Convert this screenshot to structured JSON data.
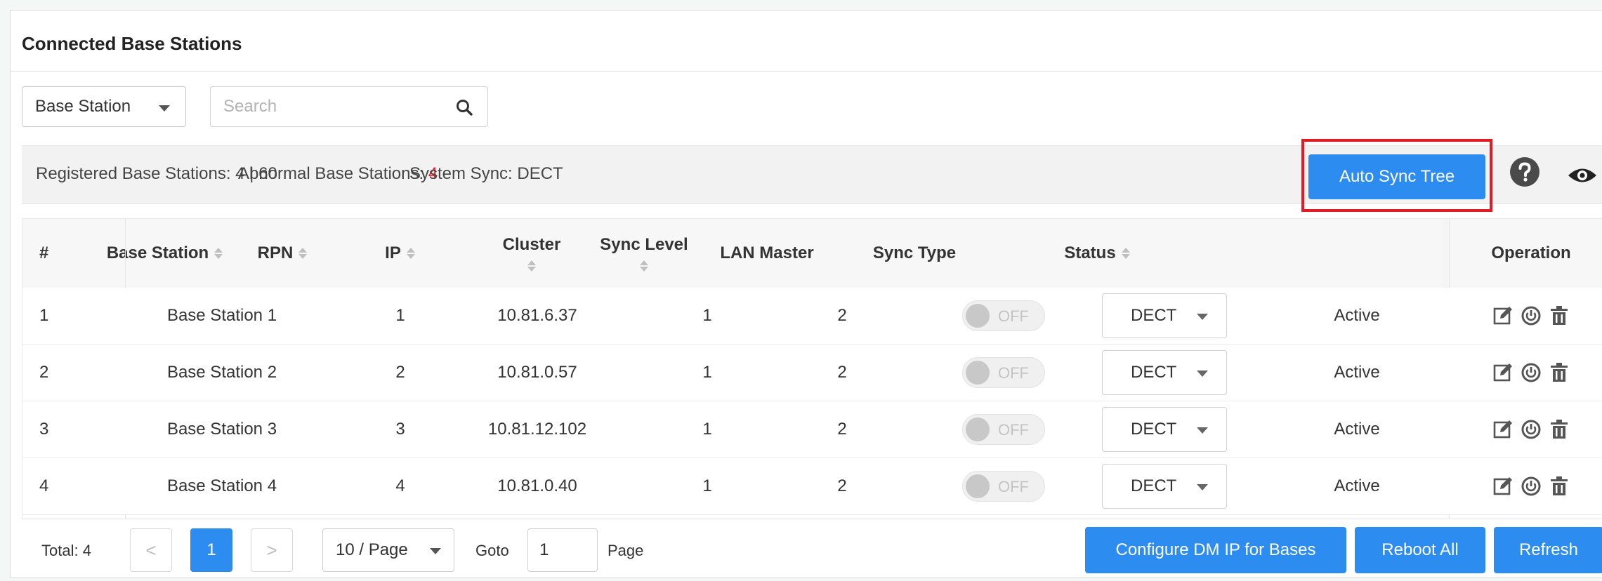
{
  "panel": {
    "title": "Connected Base Stations"
  },
  "filter": {
    "type_selected": "Base Station",
    "search_placeholder": "Search"
  },
  "stats": {
    "registered_label": "Registered Base Stations: 4 | 60",
    "abnormal_label": "Abnormal Base Stations: ",
    "abnormal_value": "4",
    "sync_label": "System Sync: DECT"
  },
  "toolbar": {
    "auto_sync_label": "Auto Sync Tree"
  },
  "table": {
    "columns": [
      "#",
      "Base Station",
      "RPN",
      "IP",
      "Cluster",
      "Sync Level",
      "LAN Master",
      "Sync Type",
      "Status",
      "Operation"
    ],
    "rows": [
      {
        "num": "1",
        "name": "Base Station 1",
        "rpn": "1",
        "ip": "10.81.6.37",
        "cluster": "1",
        "sync_level": "2",
        "lan_master": "OFF",
        "sync_type": "DECT",
        "status": "Active"
      },
      {
        "num": "2",
        "name": "Base Station 2",
        "rpn": "2",
        "ip": "10.81.0.57",
        "cluster": "1",
        "sync_level": "2",
        "lan_master": "OFF",
        "sync_type": "DECT",
        "status": "Active"
      },
      {
        "num": "3",
        "name": "Base Station 3",
        "rpn": "3",
        "ip": "10.81.12.102",
        "cluster": "1",
        "sync_level": "2",
        "lan_master": "OFF",
        "sync_type": "DECT",
        "status": "Active"
      },
      {
        "num": "4",
        "name": "Base Station 4",
        "rpn": "4",
        "ip": "10.81.0.40",
        "cluster": "1",
        "sync_level": "2",
        "lan_master": "OFF",
        "sync_type": "DECT",
        "status": "Active"
      }
    ]
  },
  "footer": {
    "total_label": "Total: 4",
    "prev_symbol": "<",
    "next_symbol": ">",
    "current_page": "1",
    "page_size": "10 / Page",
    "goto_label": "Goto",
    "goto_value": "1",
    "page_label": "Page",
    "configure_label": "Configure DM IP for Bases",
    "reboot_label": "Reboot All",
    "refresh_label": "Refresh"
  },
  "icons": {
    "search": "search-icon",
    "help": "help-icon",
    "eye": "eye-icon",
    "edit": "edit-icon",
    "power": "power-icon",
    "delete": "trash-icon"
  },
  "colors": {
    "primary": "#2d8cf0",
    "highlight_frame": "#e01b24",
    "abnormal": "#e4242c"
  }
}
